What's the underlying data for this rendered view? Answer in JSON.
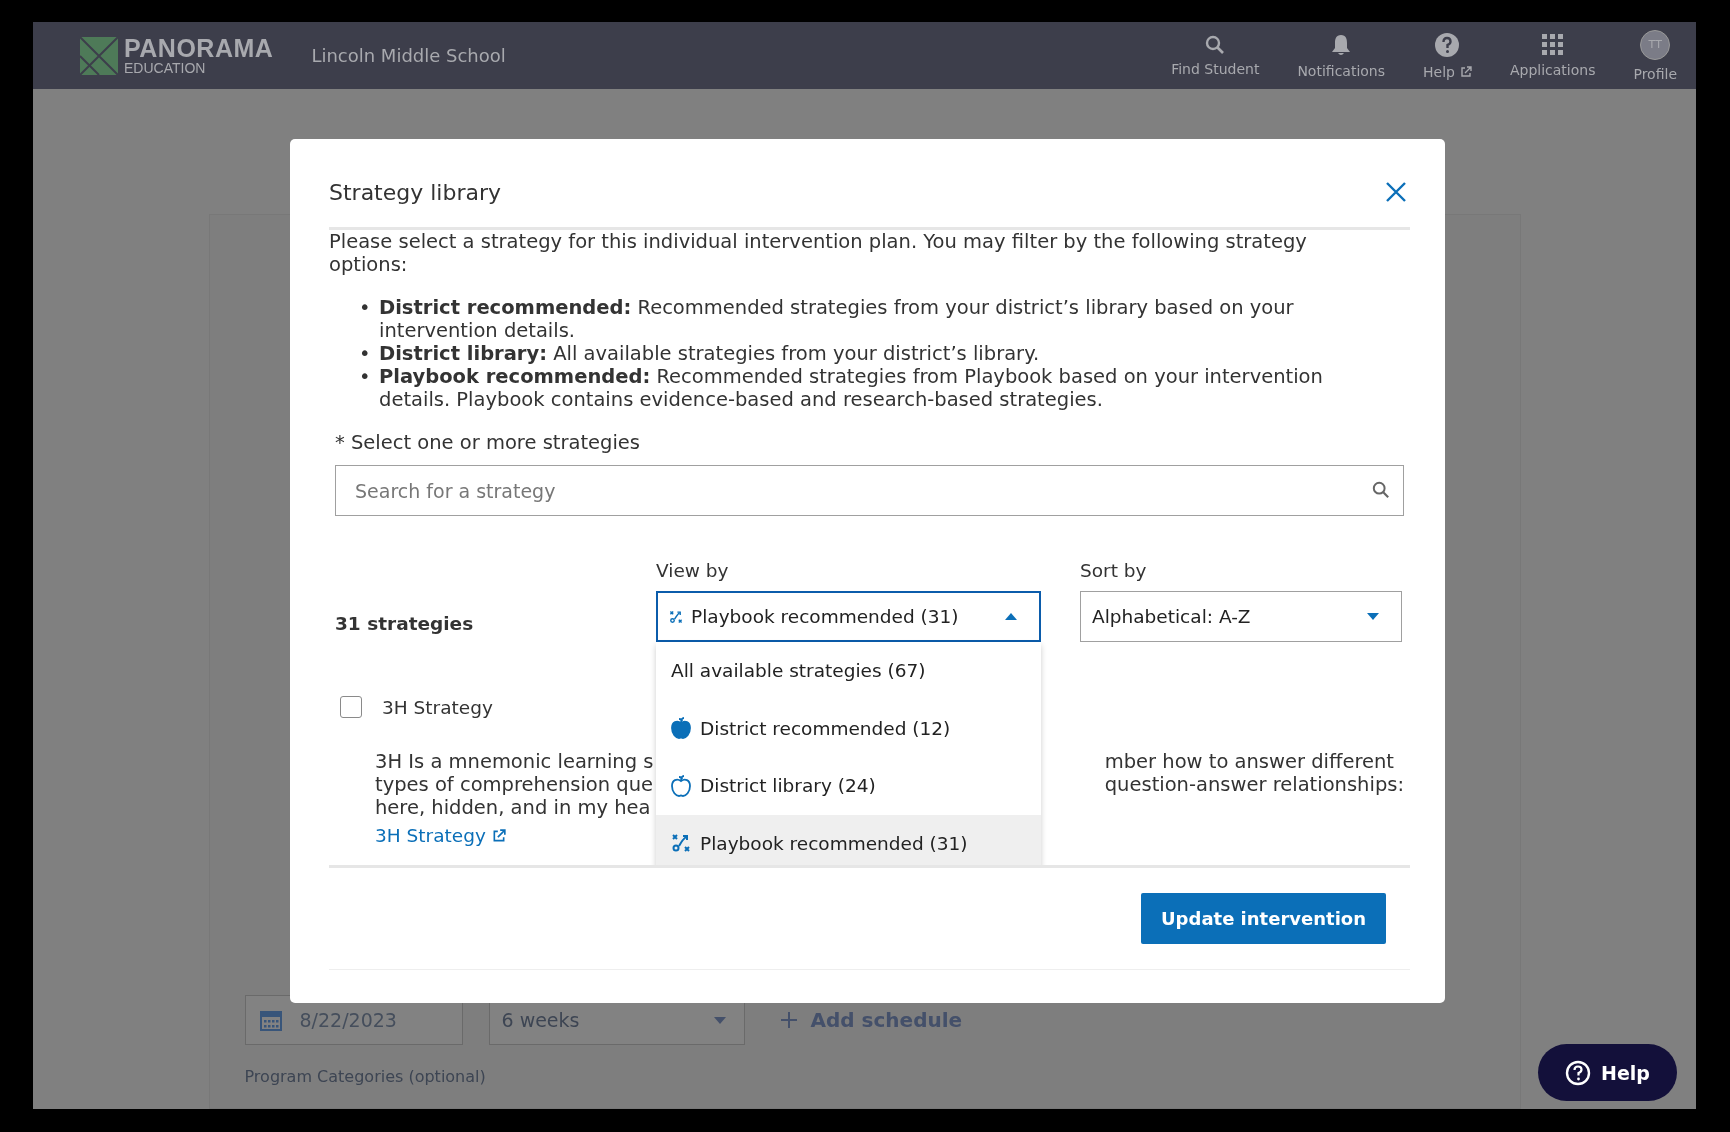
{
  "header": {
    "logo_title": "PANORAMA",
    "logo_subtitle": "EDUCATION",
    "school": "Lincoln Middle School",
    "nav": [
      {
        "label": "Find Student",
        "kind": "search"
      },
      {
        "label": "Notifications",
        "kind": "bell"
      },
      {
        "label": "Help",
        "kind": "help",
        "external": true
      },
      {
        "label": "Applications",
        "kind": "grid"
      },
      {
        "label": "Profile",
        "kind": "avatar",
        "initials": "TT"
      }
    ]
  },
  "page": {
    "start_date": "8/22/2023",
    "duration": "6 weeks",
    "add_schedule": "Add schedule",
    "categories_label": "Program Categories (optional)"
  },
  "modal": {
    "title": "Strategy library",
    "intro": "Please select a strategy for this individual intervention plan. You may filter by the following strategy options:",
    "bullet_marker": "•",
    "bullets": [
      "**District recommended:** Recommended strategies from your district’s library based on your intervention details.",
      "**District library:** All available strategies from your district’s library.",
      "**Playbook recommended:** Recommended strategies from Playbook based on your intervention details. Playbook contains evidence-based and research-based strategies."
    ],
    "select_label": "* Select one or more strategies",
    "search": {
      "placeholder": "Search for a strategy"
    },
    "count": "31 strategies",
    "view_by": {
      "label": "View by",
      "value": "Playbook recommended (31)",
      "kind": "playbook",
      "expanded": true,
      "options": [
        {
          "label": "All available strategies (67)",
          "kind": "plain",
          "selected": false
        },
        {
          "label": "District recommended (12)",
          "kind": "apple-filled",
          "selected": false
        },
        {
          "label": "District library (24)",
          "kind": "apple-outline",
          "selected": false
        },
        {
          "label": "Playbook recommended (31)",
          "kind": "playbook",
          "selected": true
        }
      ]
    },
    "sort_by": {
      "label": "Sort by",
      "value": "Alphabetical: A-Z"
    },
    "strategies": [
      {
        "name": "3H Strategy",
        "checked": false,
        "description_left": "3H Is a mnemonic learning s",
        "description_left_2": "types of comprehension que",
        "description_left_3": "here, hidden, and in my hea",
        "description_right": "mber how to answer different",
        "description_right_2": "question-answer relationships:",
        "link": "3H Strategy"
      }
    ],
    "submit": "Update intervention"
  },
  "help_button": "Help"
}
